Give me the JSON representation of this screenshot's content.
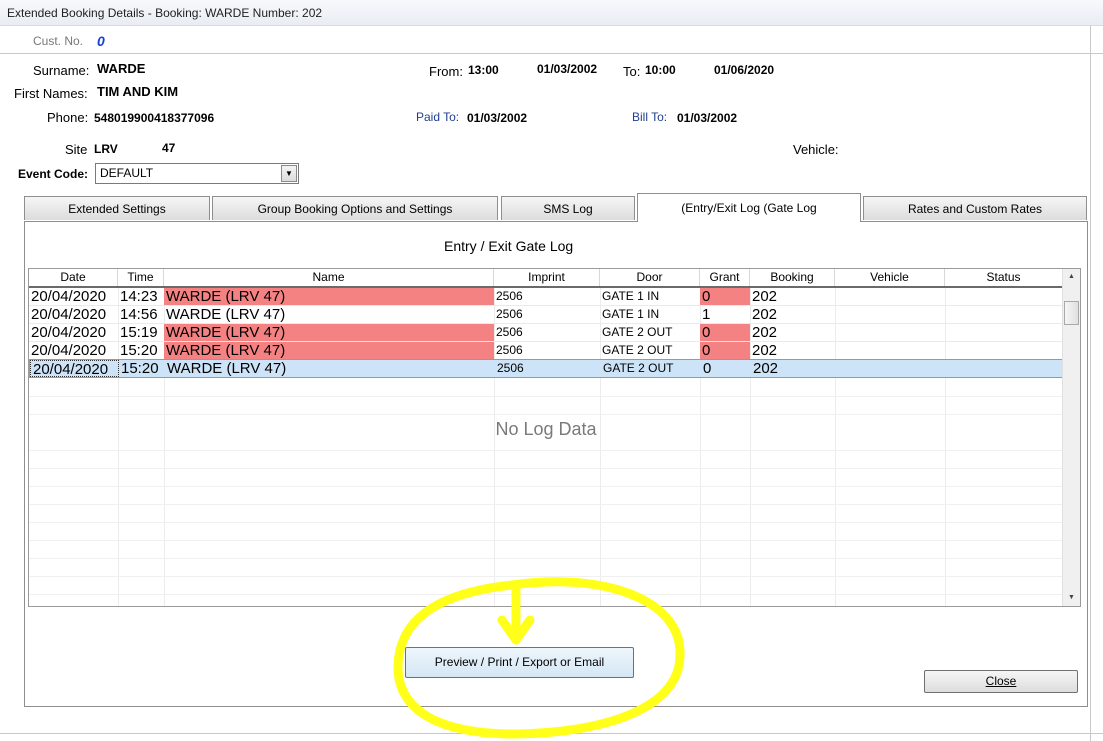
{
  "window": {
    "title": "Extended Booking Details - Booking: WARDE Number: 202"
  },
  "customer": {
    "cust_no_label": "Cust. No.",
    "cust_no": "0"
  },
  "booking": {
    "surname_label": "Surname:",
    "surname": "WARDE",
    "first_names_label": "First Names:",
    "first_names": "TIM AND KIM",
    "phone_label": "Phone:",
    "phone": "548019900418377096",
    "site_label": "Site",
    "site": "LRV",
    "site_number": "47",
    "from_label": "From:",
    "from_time": "13:00",
    "from_date": "01/03/2002",
    "to_label": "To:",
    "to_time": "10:00",
    "to_date": "01/06/2020",
    "paid_to_label": "Paid To:",
    "paid_to": "01/03/2002",
    "bill_to_label": "Bill To:",
    "bill_to": "01/03/2002",
    "vehicle_label": "Vehicle:",
    "event_code_label": "Event Code:",
    "event_code": "DEFAULT"
  },
  "tabs": [
    {
      "label": "Extended Settings"
    },
    {
      "label": "Group Booking Options and Settings"
    },
    {
      "label": "SMS Log"
    },
    {
      "label": "(Entry/Exit Log (Gate Log"
    },
    {
      "label": "Rates and Custom Rates"
    }
  ],
  "log": {
    "title": "Entry / Exit Gate Log",
    "columns": [
      "Date",
      "Time",
      "Name",
      "Imprint",
      "Door",
      "Grant",
      "Booking",
      "Vehicle",
      "Status"
    ],
    "rows": [
      {
        "date": "20/04/2020",
        "time": "14:23",
        "name": "WARDE (LRV  47)",
        "imprint": "2506",
        "door": "GATE 1 IN",
        "grant": "0",
        "booking": "202",
        "vehicle": "",
        "status": ""
      },
      {
        "date": "20/04/2020",
        "time": "14:56",
        "name": "WARDE (LRV  47)",
        "imprint": "2506",
        "door": "GATE 1 IN",
        "grant": "1",
        "booking": "202",
        "vehicle": "",
        "status": ""
      },
      {
        "date": "20/04/2020",
        "time": "15:19",
        "name": "WARDE (LRV  47)",
        "imprint": "2506",
        "door": "GATE 2 OUT",
        "grant": "0",
        "booking": "202",
        "vehicle": "",
        "status": ""
      },
      {
        "date": "20/04/2020",
        "time": "15:20",
        "name": "WARDE (LRV  47)",
        "imprint": "2506",
        "door": "GATE 2 OUT",
        "grant": "0",
        "booking": "202",
        "vehicle": "",
        "status": ""
      },
      {
        "date": "20/04/2020",
        "time": "15:20",
        "name": "WARDE (LRV  47)",
        "imprint": "2506",
        "door": "GATE 2 OUT",
        "grant": "0",
        "booking": "202",
        "vehicle": "",
        "status": ""
      }
    ],
    "no_data_text": "No Log Data"
  },
  "buttons": {
    "preview": "Preview / Print / Export or Email",
    "close": "Close"
  },
  "colors": {
    "denied_row": "#f58282",
    "selected_row": "#cde3f8",
    "annotation": "#ffff1a"
  }
}
